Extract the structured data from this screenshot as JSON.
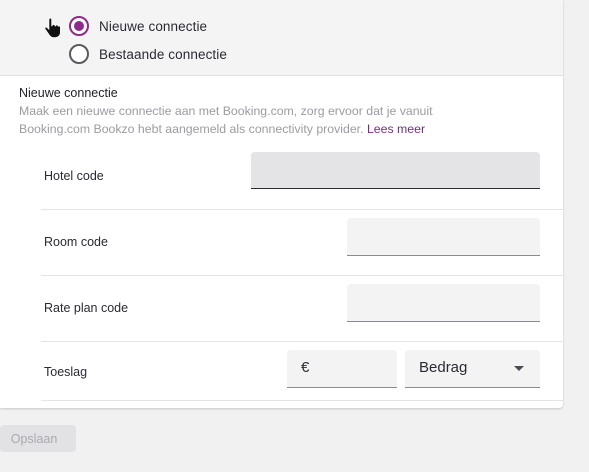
{
  "connection_type": {
    "options": [
      {
        "label": "Nieuwe connectie",
        "selected": true
      },
      {
        "label": "Bestaande connectie",
        "selected": false
      }
    ]
  },
  "section": {
    "title": "Nieuwe connectie",
    "description": "Maak een nieuwe connectie aan met Booking.com, zorg ervoor dat je vanuit Booking.com Bookzo hebt aangemeld als connectivity provider.",
    "link_text": "Lees meer"
  },
  "form": {
    "hotel_code": {
      "label": "Hotel code",
      "value": ""
    },
    "room_code": {
      "label": "Room code",
      "value": ""
    },
    "rate_plan_code": {
      "label": "Rate plan code",
      "value": ""
    },
    "surcharge": {
      "label": "Toeslag",
      "currency_symbol": "€",
      "value": "",
      "type_value": "Bedrag"
    }
  },
  "actions": {
    "save_label": "Opslaan"
  },
  "colors": {
    "accent": "#8e2a8b",
    "link": "#7a2a7f",
    "background": "#f1f1f2"
  },
  "icons": {
    "cursor": "hand-pointer-icon",
    "dropdown": "caret-down-icon"
  }
}
